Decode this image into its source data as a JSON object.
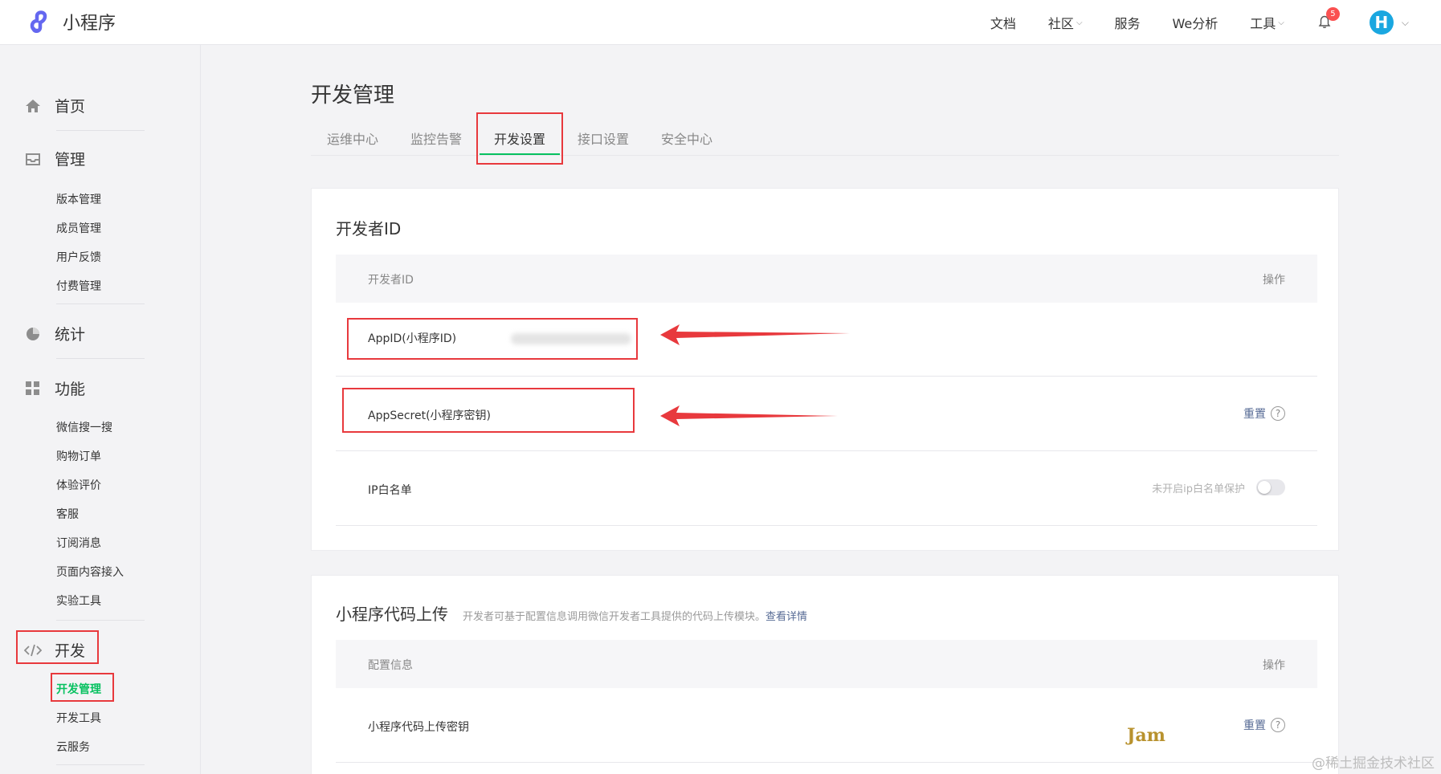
{
  "app": {
    "name": "小程序"
  },
  "topnav": {
    "items": [
      {
        "label": "文档",
        "dropdown": false
      },
      {
        "label": "社区",
        "dropdown": true
      },
      {
        "label": "服务",
        "dropdown": false
      },
      {
        "label": "We分析",
        "dropdown": false
      },
      {
        "label": "工具",
        "dropdown": true
      }
    ],
    "notification_count": "5",
    "avatar_letter": "H"
  },
  "sidebar": {
    "home": "首页",
    "manage": {
      "label": "管理",
      "items": [
        "版本管理",
        "成员管理",
        "用户反馈",
        "付费管理"
      ]
    },
    "stats": "统计",
    "features": {
      "label": "功能",
      "items": [
        "微信搜一搜",
        "购物订单",
        "体验评价",
        "客服",
        "订阅消息",
        "页面内容接入",
        "实验工具"
      ]
    },
    "dev": {
      "label": "开发",
      "items": [
        "开发管理",
        "开发工具",
        "云服务"
      ],
      "active_item": "开发管理"
    }
  },
  "main": {
    "title": "开发管理",
    "tabs": [
      "运维中心",
      "监控告警",
      "开发设置",
      "接口设置",
      "安全中心"
    ],
    "active_tab": "开发设置"
  },
  "dev_id_card": {
    "title": "开发者ID",
    "header": {
      "col1": "开发者ID",
      "col2": "操作"
    },
    "rows": [
      {
        "label": "AppID(小程序ID)"
      },
      {
        "label": "AppSecret(小程序密钥)",
        "action": "重置"
      },
      {
        "label": "IP白名单",
        "status": "未开启ip白名单保护"
      }
    ]
  },
  "upload_card": {
    "title": "小程序代码上传",
    "subtitle": "开发者可基于配置信息调用微信开发者工具提供的代码上传模块。",
    "link": "查看详情",
    "header": {
      "col1": "配置信息",
      "col2": "操作"
    },
    "rows": [
      {
        "label": "小程序代码上传密钥",
        "action": "重置"
      }
    ]
  },
  "watermarks": {
    "jam": "Jam",
    "site": "@稀土掘金技术社区"
  },
  "colors": {
    "accent": "#07c160",
    "link": "#576b95",
    "highlight": "#e8393d",
    "badge": "#fa5151"
  }
}
